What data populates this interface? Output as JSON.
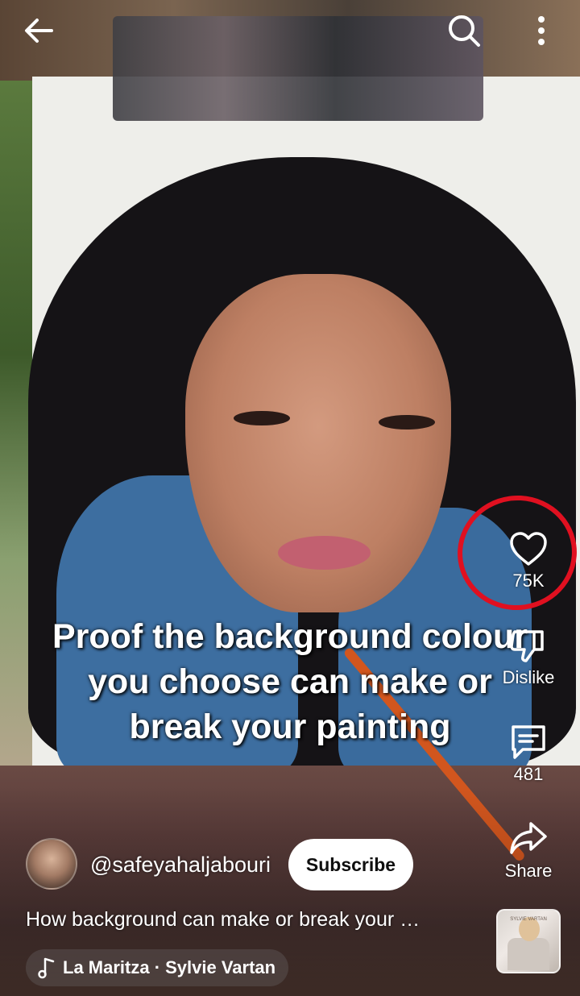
{
  "video": {
    "caption_lines": [
      "Proof the background colour",
      "you choose can make or",
      "break your painting"
    ]
  },
  "top_bar": {
    "back_icon": "arrow-left-icon",
    "search_icon": "search-icon",
    "more_icon": "more-vert-icon"
  },
  "actions": {
    "like": {
      "count": "75K",
      "icon": "heart-icon"
    },
    "dislike": {
      "label": "Dislike",
      "icon": "thumb-down-icon"
    },
    "comments": {
      "count": "481",
      "icon": "comment-icon"
    },
    "share": {
      "label": "Share",
      "icon": "share-icon"
    }
  },
  "annotation": {
    "color": "#e01020"
  },
  "channel": {
    "handle": "@safeyahaljabouri",
    "subscribe_label": "Subscribe"
  },
  "title": "How background can make or break your …",
  "music": {
    "icon": "music-note-icon",
    "track": "La Maritza · Sylvie Vartan",
    "album_text": "SYLVIE VARTAN"
  }
}
